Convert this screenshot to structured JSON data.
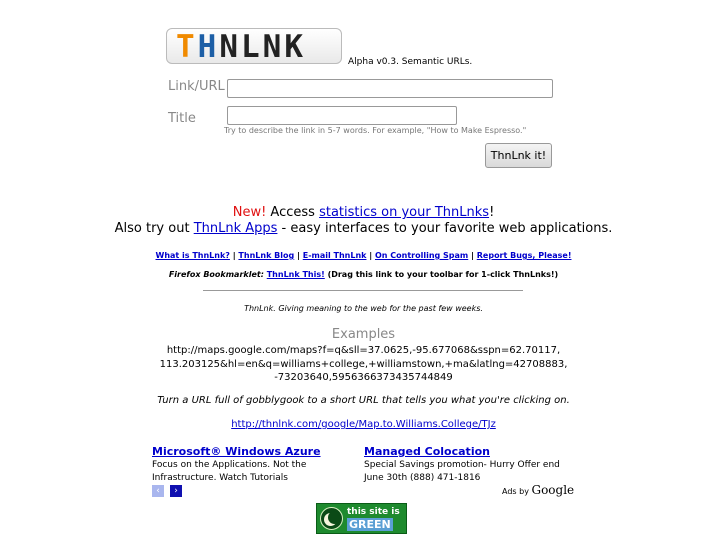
{
  "logo": {
    "t": "T",
    "h": "H",
    "rest": "NLNK"
  },
  "tagline": "Alpha v0.3. Semantic URLs.",
  "form": {
    "link_label": "Link/URL",
    "title_label": "Title",
    "link_value": "",
    "title_value": "",
    "hint": "Try to describe the link in 5-7 words. For example, \"How to Make Espresso.\"",
    "submit_label": "ThnLnk it!"
  },
  "announce": {
    "new": "New!",
    "access": " Access ",
    "stats_link": "statistics on your ThnLnks",
    "bang": "!",
    "also": "Also try out ",
    "apps_link": "ThnLnk Apps",
    "apps_rest": " - easy interfaces to your favorite web applications."
  },
  "nav": {
    "links": [
      "What is ThnLnk?",
      "ThnLnk Blog",
      "E-mail ThnLnk",
      "On Controlling Spam",
      "Report Bugs, Please!"
    ],
    "sep": " | "
  },
  "bookmarklet": {
    "label": "Firefox Bookmarklet:",
    "link": "ThnLnk This!",
    "note": " (Drag this link to your toolbar for 1-click ThnLnks!)"
  },
  "motto": "ThnLnk. Giving meaning to the web for the past few weeks.",
  "examples": {
    "heading": "Examples",
    "url_line1": "http://maps.google.com/maps?f=q&sll=37.0625,-95.677068&sspn=62.70117,",
    "url_line2": "113.203125&hl=en&q=williams+college,+williamstown,+ma&latlng=42708883,",
    "url_line3": "-73203640,5956366373435744849",
    "turn": "Turn a URL full of gobblygook to a short URL that tells you what you're clicking on.",
    "short_link": "http://thnlnk.com/google/Map.to.Williams.College/TJz"
  },
  "ads": {
    "items": [
      {
        "title": "Microsoft® Windows Azure",
        "line1": "Focus on the Applications. Not the",
        "line2": "Infrastructure. Watch Tutorials"
      },
      {
        "title": "Managed Colocation",
        "line1": "Special Savings promotion- Hurry Offer end",
        "line2": "June 30th (888) 471-1816"
      }
    ],
    "prev_icon": "‹",
    "next_icon": "›",
    "ads_by": "Ads by",
    "google": "Google"
  },
  "badge": {
    "line1": "this site is",
    "line2": "GREEN"
  }
}
